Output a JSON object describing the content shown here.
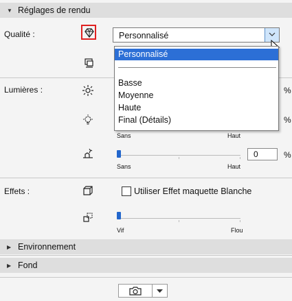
{
  "sections": {
    "render": {
      "title": "Réglages de rendu"
    },
    "environment": {
      "title": "Environnement"
    },
    "background": {
      "title": "Fond"
    }
  },
  "quality": {
    "label": "Qualité :",
    "selected": "Personnalisé",
    "options": [
      "Personnalisé",
      "Basse",
      "Moyenne",
      "Haute",
      "Final (Détails)"
    ]
  },
  "lights": {
    "label": "Lumières :",
    "row1_unit": "%",
    "row2_unit": "%",
    "row2_min": "Sans",
    "row2_max": "Haut",
    "row3_min": "Sans",
    "row3_max": "Haut",
    "row3_value": "0",
    "row3_unit": "%",
    "row3_slider_fraction": 0.0
  },
  "effects": {
    "label": "Effets :",
    "checkbox_label": "Utiliser Effet maquette Blanche",
    "checked": false,
    "slider_min": "Vif",
    "slider_max": "Flou",
    "slider_fraction": 0.0
  },
  "icons": {
    "quality": "diamond-icon",
    "quality_sub": "render-preview-icon",
    "light1": "sun-icon",
    "light2": "bulb-icon",
    "light3": "hand-lamp-icon",
    "effect1": "cube-icon",
    "effect2": "blur-squares-icon",
    "camera": "camera-icon",
    "dropdown": "chevron-down-icon"
  },
  "colors": {
    "highlight": "#2c6fd6",
    "red_box": "#e02020",
    "slider_thumb": "#2266cc",
    "header_bg": "#dedede"
  }
}
